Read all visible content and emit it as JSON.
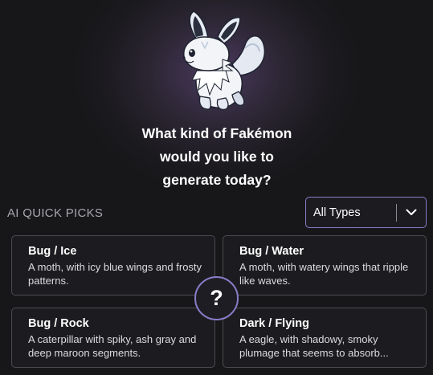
{
  "header": {
    "mascot_icon": "fakemon-fox-mascot",
    "prompt_lines": [
      "What kind of Fakémon",
      "would you like to",
      "generate today?"
    ]
  },
  "quick_picks": {
    "label": "AI QUICK PICKS",
    "type_filter": {
      "value": "All Types",
      "icon": "chevron-down-icon"
    },
    "random_button": {
      "label": "?",
      "icon": "question-icon"
    },
    "cards": [
      {
        "title": "Bug / Ice",
        "description": "A moth, with icy blue wings and frosty patterns."
      },
      {
        "title": "Bug / Water",
        "description": "A moth, with watery wings that ripple like waves."
      },
      {
        "title": "Bug / Rock",
        "description": "A caterpillar with spiky, ash gray and deep maroon segments."
      },
      {
        "title": "Dark / Flying",
        "description": "A eagle, with shadowy, smoky plumage that seems to absorb..."
      }
    ]
  },
  "colors": {
    "accent": "#8b7cc8",
    "background": "#17171a",
    "card_border": "#4a4a51",
    "muted_text": "#a6a6ad"
  }
}
